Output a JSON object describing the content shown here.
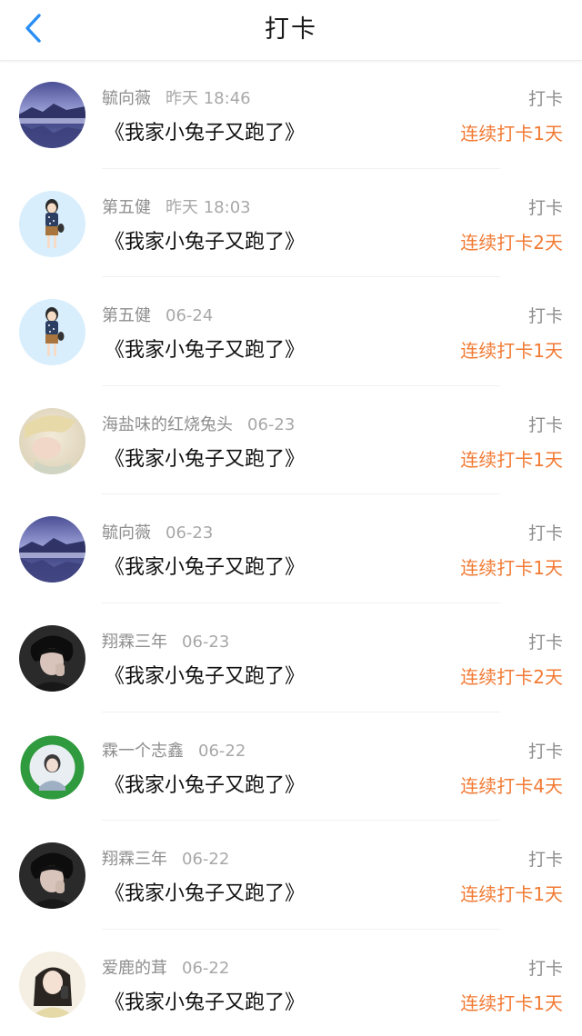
{
  "header": {
    "title": "打卡",
    "back_icon": "chevron-left-icon",
    "accent_color": "#2a8ef5"
  },
  "entries": [
    {
      "name": "毓向薇",
      "time": "昨天 18:46",
      "book": "《我家小兔子又跑了》",
      "type": "打卡",
      "streak": "连续打卡1天",
      "avatar": "lake-landscape"
    },
    {
      "name": "第五健",
      "time": "昨天 18:03",
      "book": "《我家小兔子又跑了》",
      "type": "打卡",
      "streak": "连续打卡2天",
      "avatar": "cartoon-girl"
    },
    {
      "name": "第五健",
      "time": "06-24",
      "book": "《我家小兔子又跑了》",
      "type": "打卡",
      "streak": "连续打卡1天",
      "avatar": "cartoon-girl"
    },
    {
      "name": "海盐味的红烧兔头",
      "time": "06-23",
      "book": "《我家小兔子又跑了》",
      "type": "打卡",
      "streak": "连续打卡1天",
      "avatar": "blonde-portrait"
    },
    {
      "name": "毓向薇",
      "time": "06-23",
      "book": "《我家小兔子又跑了》",
      "type": "打卡",
      "streak": "连续打卡1天",
      "avatar": "lake-landscape"
    },
    {
      "name": "翔霖三年",
      "time": "06-23",
      "book": "《我家小兔子又跑了》",
      "type": "打卡",
      "streak": "连续打卡2天",
      "avatar": "dark-portrait"
    },
    {
      "name": "霖一个志鑫",
      "time": "06-22",
      "book": "《我家小兔子又跑了》",
      "type": "打卡",
      "streak": "连续打卡4天",
      "avatar": "green-badge-portrait"
    },
    {
      "name": "翔霖三年",
      "time": "06-22",
      "book": "《我家小兔子又跑了》",
      "type": "打卡",
      "streak": "连续打卡1天",
      "avatar": "dark-portrait"
    },
    {
      "name": "爱鹿的茸",
      "time": "06-22",
      "book": "《我家小兔子又跑了》",
      "type": "打卡",
      "streak": "连续打卡1天",
      "avatar": "girl-portrait"
    }
  ],
  "colors": {
    "streak": "#f27a33",
    "meta": "#8e8e8e",
    "book": "#111111"
  }
}
